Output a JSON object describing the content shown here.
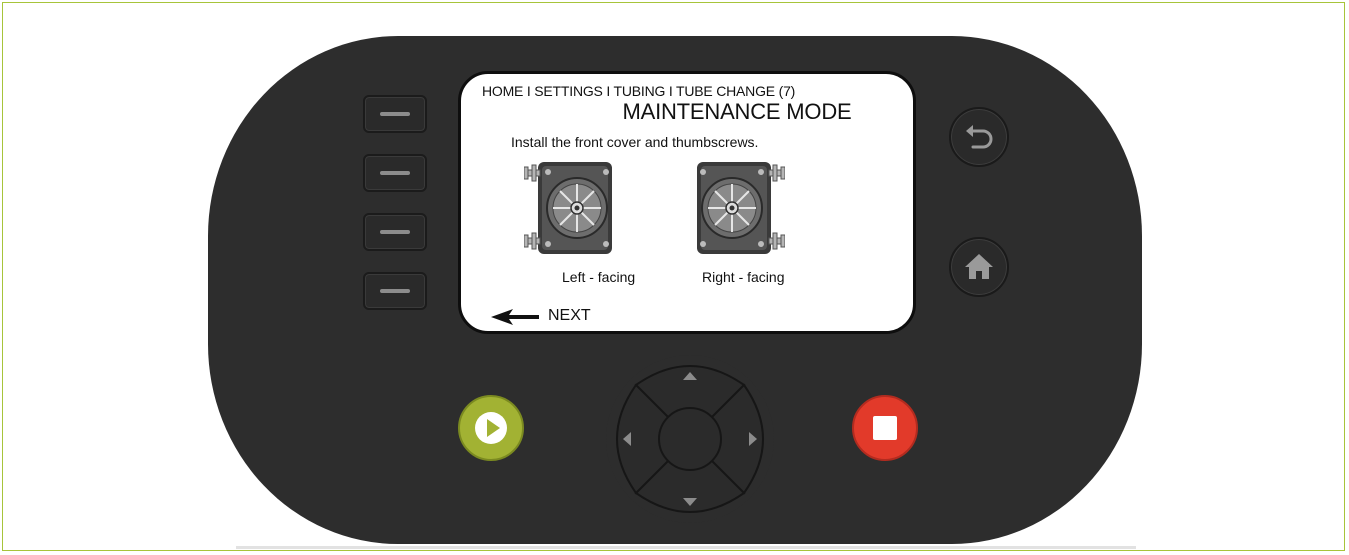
{
  "screen": {
    "breadcrumb": "HOME I SETTINGS I TUBING I TUBE CHANGE (7)",
    "title": "MAINTENANCE MODE",
    "instruction": "Install the front cover and thumbscrews.",
    "images": [
      {
        "caption": "Left - facing"
      },
      {
        "caption": "Right - facing"
      }
    ],
    "next_label": "NEXT"
  },
  "colors": {
    "device_body": "#2d2d2d",
    "play_button": "#a2b233",
    "stop_button": "#e23a2a",
    "frame_border": "#a7c43a"
  },
  "icons": {
    "back": "back-arrow-icon",
    "home": "home-icon",
    "play": "play-icon",
    "stop": "stop-icon"
  }
}
